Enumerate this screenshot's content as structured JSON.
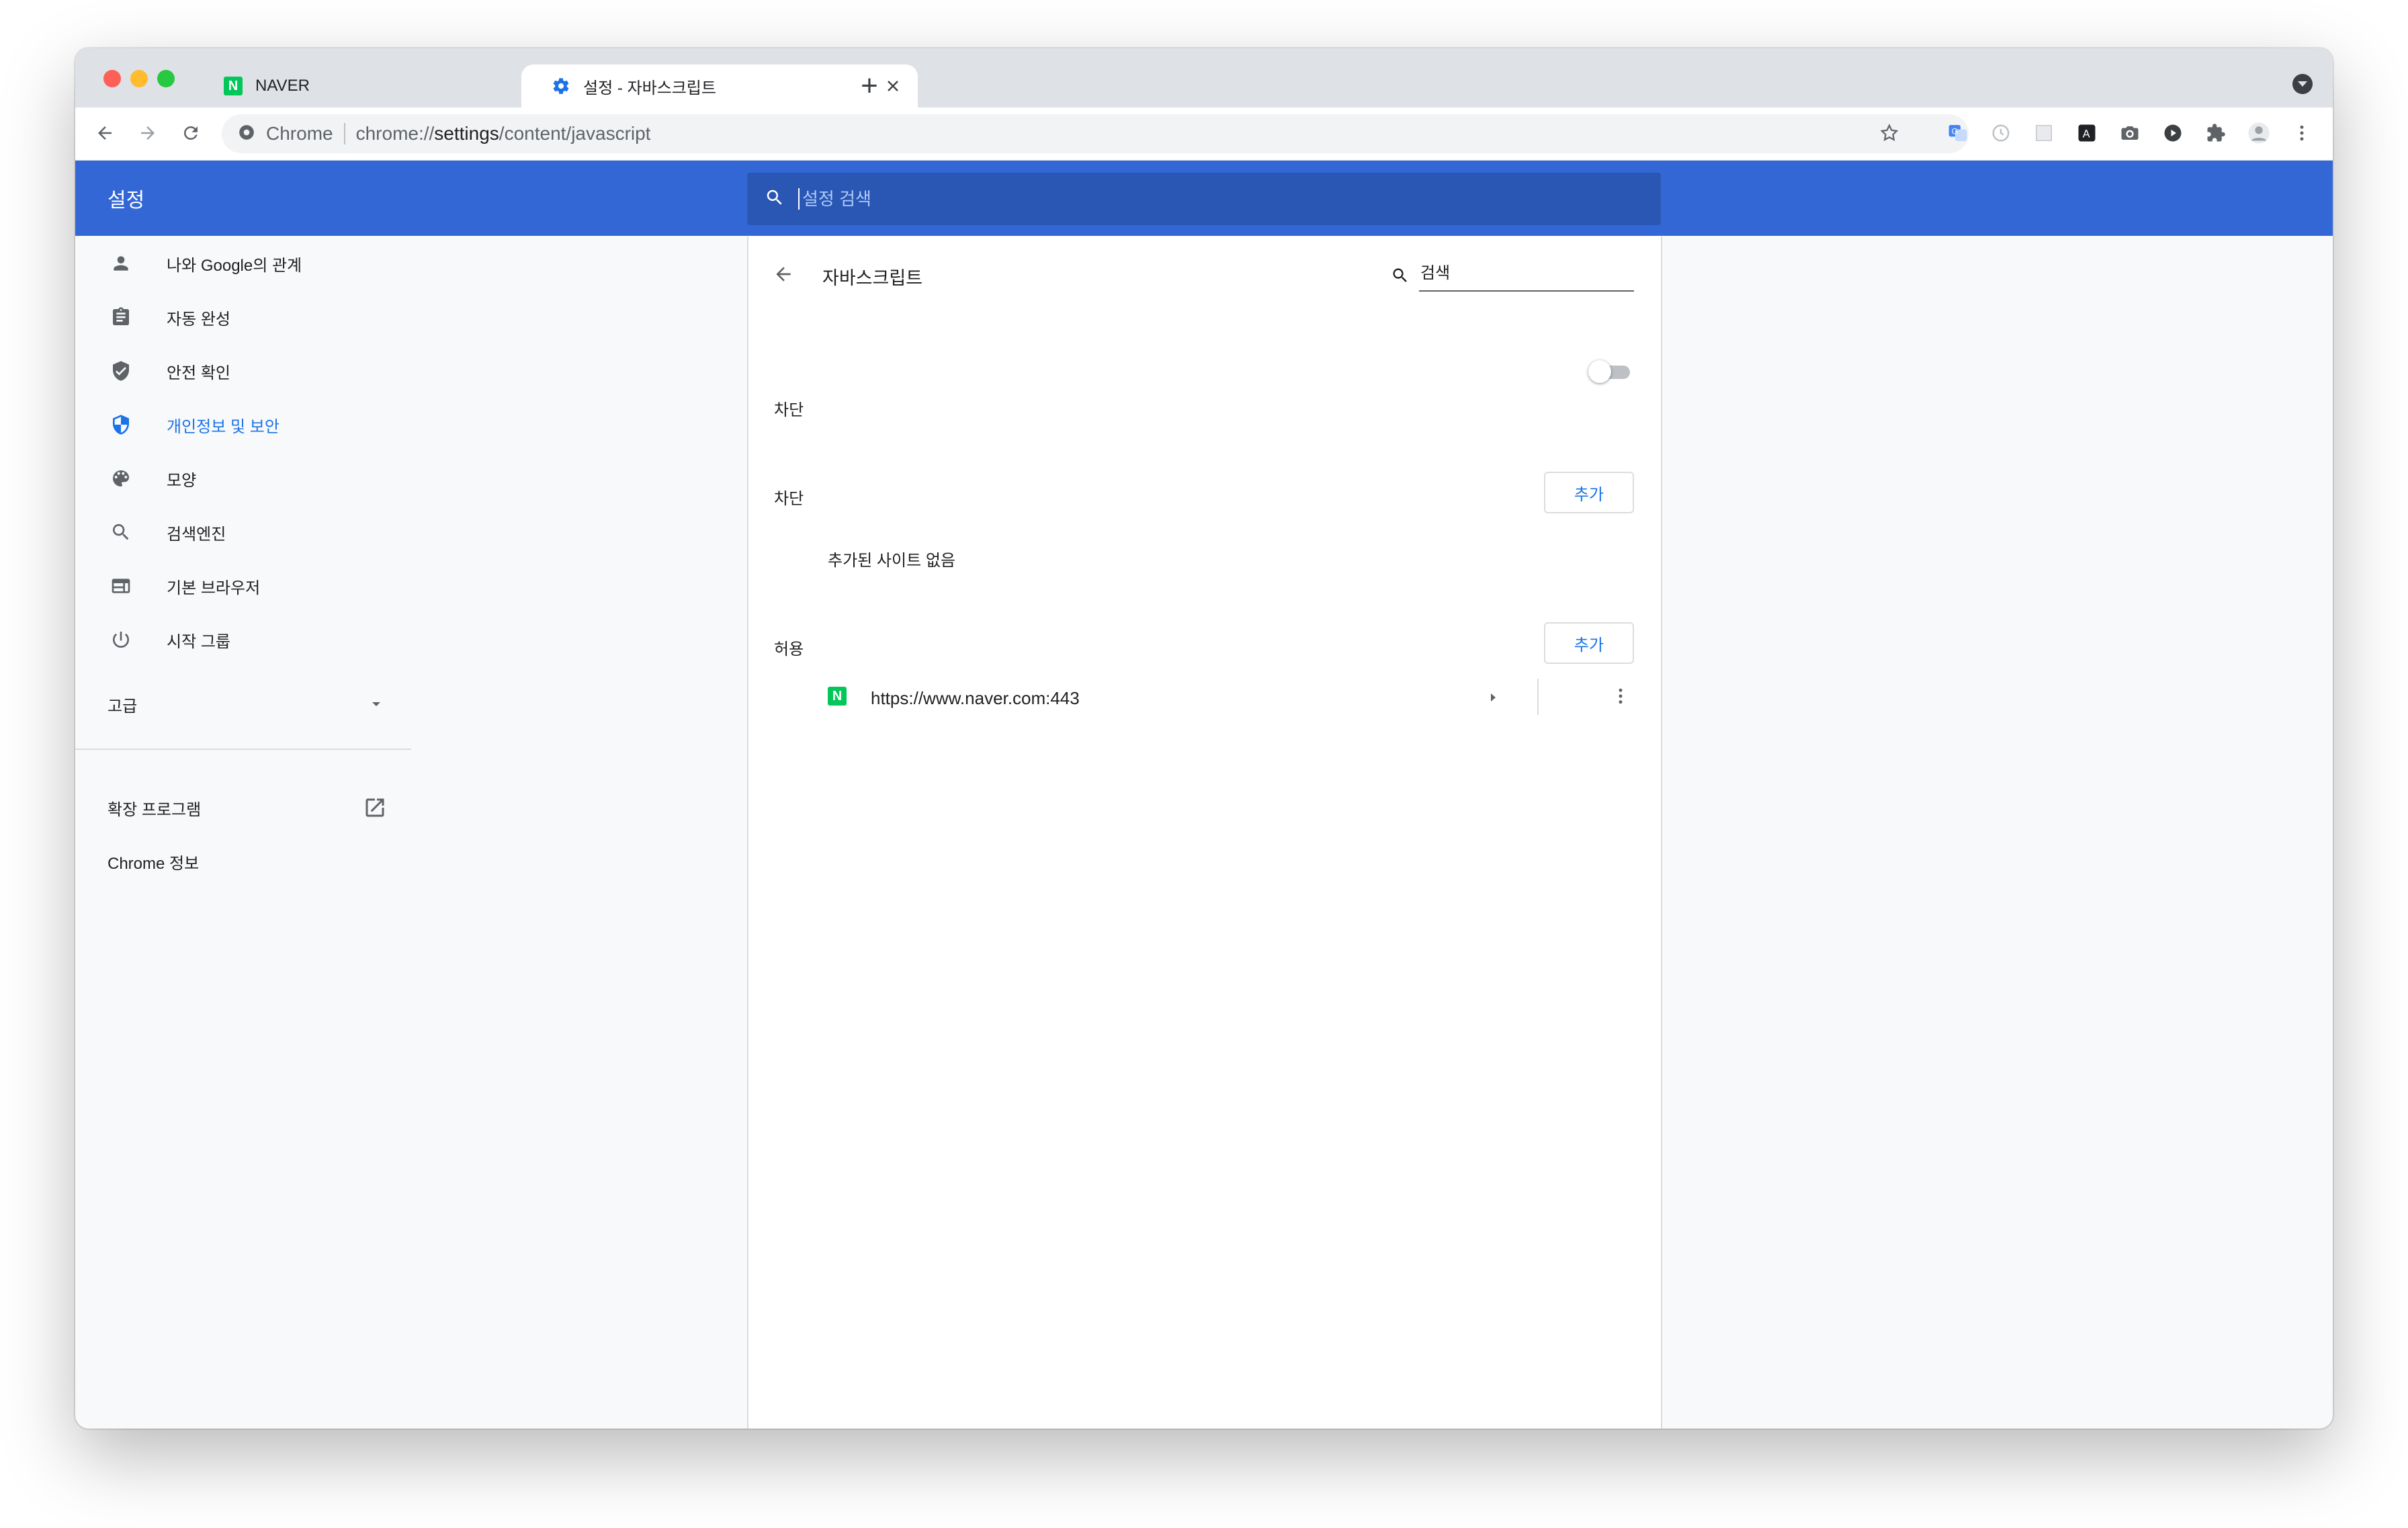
{
  "tabs": [
    {
      "title": "NAVER",
      "favicon": "naver-icon"
    },
    {
      "title": "설정 - 자바스크립트",
      "favicon": "gear-icon"
    }
  ],
  "address": {
    "site_label": "Chrome",
    "url_prefix": "chrome://",
    "url_host": "settings",
    "url_path": "/content/javascript"
  },
  "header": {
    "title": "설정",
    "search_placeholder": "설정 검색"
  },
  "sidebar": {
    "items": [
      {
        "label": "나와 Google의 관계",
        "icon": "person-icon"
      },
      {
        "label": "자동 완성",
        "icon": "clipboard-icon"
      },
      {
        "label": "안전 확인",
        "icon": "shield-check-icon"
      },
      {
        "label": "개인정보 및 보안",
        "icon": "shield-icon",
        "selected": true
      },
      {
        "label": "모양",
        "icon": "palette-icon"
      },
      {
        "label": "검색엔진",
        "icon": "search-icon"
      },
      {
        "label": "기본 브라우저",
        "icon": "browser-icon"
      },
      {
        "label": "시작 그룹",
        "icon": "power-icon"
      }
    ],
    "advanced": "고급",
    "extensions": "확장 프로그램",
    "about": "Chrome 정보"
  },
  "subpage": {
    "title": "자바스크립트",
    "search_placeholder": "검색",
    "toggle_label": "차단",
    "toggle_on": false,
    "block_section": {
      "label": "차단",
      "add": "추가",
      "empty": "추가된 사이트 없음"
    },
    "allow_section": {
      "label": "허용",
      "add": "추가"
    },
    "allowed_sites": [
      {
        "url": "https://www.naver.com:443",
        "favicon": "naver-icon"
      }
    ]
  },
  "colors": {
    "header_blue": "#3367d6",
    "search_blue": "#2a56b4",
    "accent": "#1a73e8",
    "naver_green": "#03c75a"
  }
}
